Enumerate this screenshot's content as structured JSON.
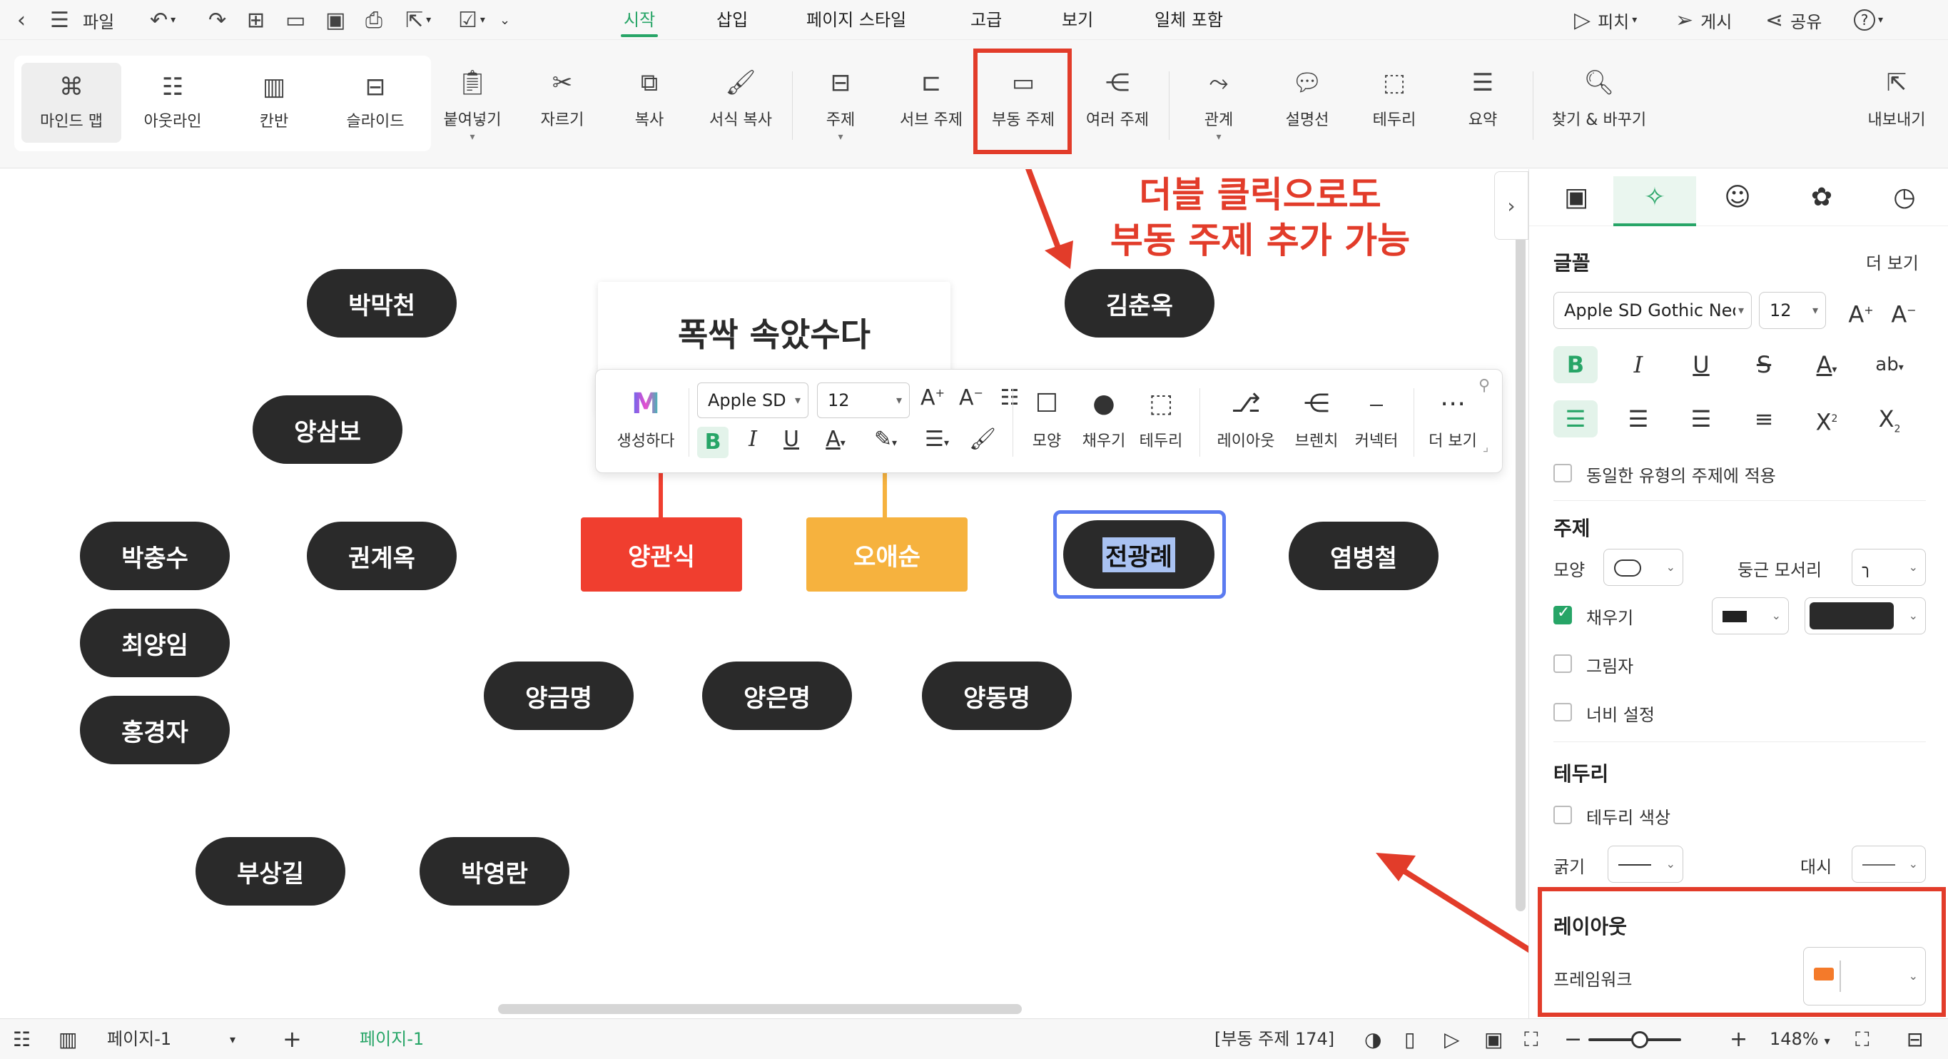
{
  "menubar": {
    "file_label": "파일",
    "tabs": [
      "시작",
      "삽입",
      "페이지 스타일",
      "고급",
      "보기",
      "일체 포함"
    ],
    "active_tab": "시작",
    "right": {
      "pitch": "피치",
      "publish": "게시",
      "share": "공유",
      "help": "?"
    }
  },
  "ribbon": {
    "views": [
      "마인드 맵",
      "아웃라인",
      "칸반",
      "슬라이드"
    ],
    "buttons": [
      "붙여넣기",
      "자르기",
      "복사",
      "서식 복사",
      "주제",
      "서브 주제",
      "부동 주제",
      "여러 주제",
      "관계",
      "설명선",
      "테두리",
      "요약",
      "찾기 & 바꾸기",
      "내보내기"
    ]
  },
  "annotation": {
    "line1": "더블 클릭으로도",
    "line2": "부동 주제 추가 가능"
  },
  "canvas": {
    "card_title": "폭싹 속았수다",
    "nodes": [
      "박막천",
      "양삼보",
      "박충수",
      "권계옥",
      "최양임",
      "홍경자",
      "부상길",
      "박영란",
      "김춘옥",
      "염병철",
      "양금명",
      "양은명",
      "양동명"
    ],
    "red_node": "양관식",
    "yellow_node": "오애순",
    "selected_node": "전광례"
  },
  "float_toolbar": {
    "generate": "생성하다",
    "font": "Apple SD",
    "size": "12",
    "bold": "B",
    "italic": "I",
    "underline": "U",
    "color_a": "A",
    "buttons": [
      "모양",
      "채우기",
      "테두리",
      "레이아웃",
      "브렌치",
      "커넥터",
      "더 보기"
    ]
  },
  "panel": {
    "font_section": "글꼴",
    "more": "더 보기",
    "font_name": "Apple SD Gothic Neo",
    "font_size": "12",
    "apply_same": "동일한 유형의 주제에 적용",
    "topic_section": "주제",
    "shape_label": "모양",
    "corner_label": "둥근 모서리",
    "fill_label": "채우기",
    "shadow_label": "그림자",
    "width_label": "너비 설정",
    "border_section": "테두리",
    "border_color_label": "테두리 색상",
    "thickness_label": "굵기",
    "dash_label": "대시",
    "layout_section": "레이아웃",
    "framework_label": "프레임워크"
  },
  "status": {
    "page_select": "페이지-1",
    "page_tab": "페이지-1",
    "topic_count": "[부동 주제 174]",
    "zoom": "148%"
  },
  "colors": {
    "accent": "#27a567",
    "node_dark": "#2a2a2a",
    "node_red": "#f03e2f",
    "node_yellow": "#f6b23e",
    "selection_blue": "#5b7bf0",
    "annotation_red": "#e23c2a"
  }
}
